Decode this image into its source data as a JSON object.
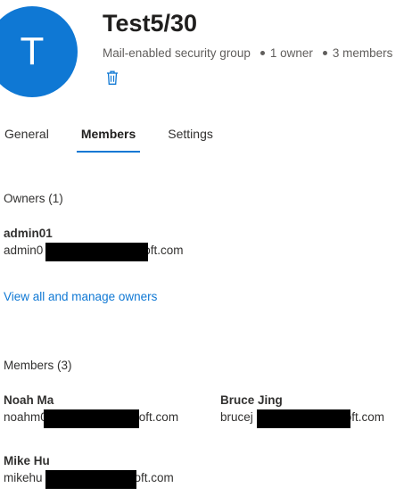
{
  "header": {
    "avatar_initial": "T",
    "title": "Test5/30",
    "type_label": "Mail-enabled security group",
    "owners_count": "1 owner",
    "members_count": "3 members",
    "delete_icon": "trash-icon"
  },
  "tabs": [
    {
      "label": "General",
      "active": false
    },
    {
      "label": "Members",
      "active": true
    },
    {
      "label": "Settings",
      "active": false
    }
  ],
  "owners": {
    "heading": "Owners (1)",
    "items": [
      {
        "name": "admin01",
        "email_prefix": "admin0",
        "email_suffix": "oft.com"
      }
    ],
    "manage_link": "View all and manage owners"
  },
  "members": {
    "heading": "Members (3)",
    "items": [
      {
        "name": "Noah Ma",
        "email_prefix": "noahm0",
        "email_suffix": "oft.com"
      },
      {
        "name": "Bruce Jing",
        "email_prefix": "brucej",
        "email_suffix": "oft.com"
      },
      {
        "name": "Mike Hu",
        "email_prefix": "mikehu",
        "email_suffix": "oft.com"
      }
    ]
  },
  "colors": {
    "accent": "#0f78d4",
    "redaction": "#000000"
  }
}
